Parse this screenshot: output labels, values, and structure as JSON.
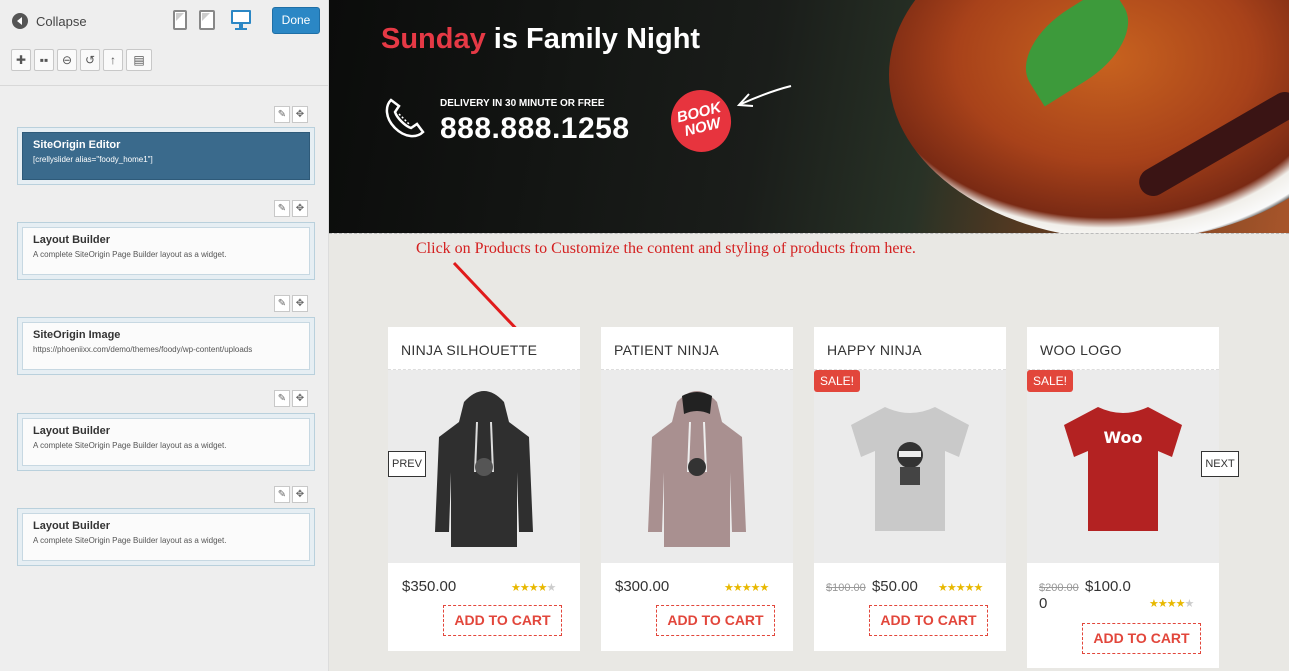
{
  "sidebar": {
    "collapse_label": "Collapse",
    "done_label": "Done",
    "widgets": [
      {
        "title": "SiteOrigin Editor",
        "desc": "[crellyslider alias=\"foody_home1\"]"
      },
      {
        "title": "Layout Builder",
        "desc": "A complete SiteOrigin Page Builder layout as a widget."
      },
      {
        "title": "SiteOrigin Image",
        "desc": "https://phoeniixx.com/demo/themes/foody/wp-content/uploads"
      },
      {
        "title": "Layout Builder",
        "desc": "A complete SiteOrigin Page Builder layout as a widget."
      },
      {
        "title": "Layout Builder",
        "desc": "A complete SiteOrigin Page Builder layout as a widget."
      }
    ]
  },
  "hero": {
    "headline_red": "Sunday",
    "headline_rest": " is Family Night",
    "delivery": "DELIVERY IN 30 MINUTE OR FREE",
    "phone": "888.888.1258",
    "book_line1": "BOOK",
    "book_line2": "NOW"
  },
  "annotation": "Click on Products to Customize the content and styling of products from here.",
  "carousel": {
    "prev": "PREV",
    "next": "NEXT"
  },
  "products": [
    {
      "title": "NINJA SILHOUETTE",
      "sale": "",
      "old_price": "",
      "price": "$350.00",
      "price_tail": "",
      "rating": 4,
      "cart": "ADD TO CART",
      "shirt_color": "#2f2f2f"
    },
    {
      "title": "PATIENT NINJA",
      "sale": "",
      "old_price": "",
      "price": "$300.00",
      "price_tail": "",
      "rating": 5,
      "cart": "ADD TO CART",
      "shirt_color": "#a99090"
    },
    {
      "title": "HAPPY NINJA",
      "sale": "SALE!",
      "old_price": "$100.00",
      "price": "$50.00",
      "price_tail": "",
      "rating": 5,
      "cart": "ADD TO CART",
      "shirt_color": "#c9c9c9"
    },
    {
      "title": "WOO LOGO",
      "sale": "SALE!",
      "old_price": "$200.00",
      "price": "$100.0",
      "price_tail": "0",
      "rating": 4,
      "cart": "ADD TO CART",
      "shirt_color": "#b32222",
      "shirt_text": "Woo"
    }
  ],
  "colors": {
    "accent": "#e2463b",
    "done": "#2b87c5",
    "active_widget": "#3a6a8c",
    "annotation": "#d42020"
  }
}
